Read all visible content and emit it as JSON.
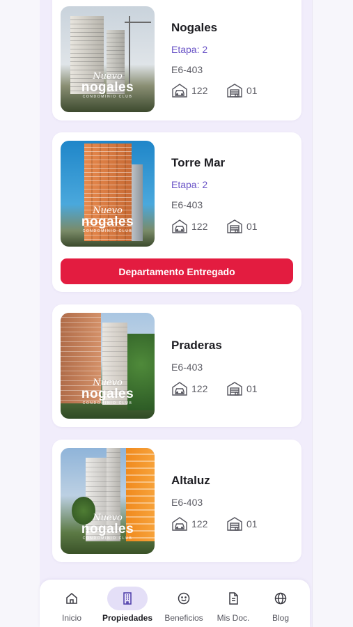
{
  "properties": [
    {
      "name": "Nogales",
      "stage": "Etapa: 2",
      "unit": "E6-403",
      "parking": "122",
      "storage": "01",
      "logo": {
        "line1": "Nuevo",
        "line2": "nogales",
        "line3": "CONDOMINIO CLUB"
      }
    },
    {
      "name": "Torre Mar",
      "stage": "Etapa: 2",
      "unit": "E6-403",
      "parking": "122",
      "storage": "01",
      "logo": {
        "line1": "Nuevo",
        "line2": "nogales",
        "line3": "CONDOMINIO CLUB"
      },
      "status_button": "Departamento Entregado"
    },
    {
      "name": "Praderas",
      "unit": "E6-403",
      "parking": "122",
      "storage": "01",
      "logo": {
        "line1": "Nuevo",
        "line2": "nogales",
        "line3": "CONDOMINIO CLUB"
      }
    },
    {
      "name": "Altaluz",
      "unit": "E6-403",
      "parking": "122",
      "storage": "01",
      "logo": {
        "line1": "Nuevo",
        "line2": "nogales",
        "line3": "CONDOMINIO CLUB"
      }
    }
  ],
  "icons": {
    "parking": "car-garage-icon",
    "storage": "storage-unit-icon"
  },
  "nav": {
    "items": [
      {
        "label": "Inicio",
        "icon": "home-icon"
      },
      {
        "label": "Propiedades",
        "icon": "building-icon",
        "active": true
      },
      {
        "label": "Beneficios",
        "icon": "smile-icon"
      },
      {
        "label": "Mis Doc.",
        "icon": "document-icon"
      },
      {
        "label": "Blog",
        "icon": "globe-icon"
      }
    ]
  },
  "colors": {
    "accent": "#6b55c7",
    "delivered": "#e31c40",
    "active_pill": "#e4dff7",
    "background": "#f1edfb"
  }
}
